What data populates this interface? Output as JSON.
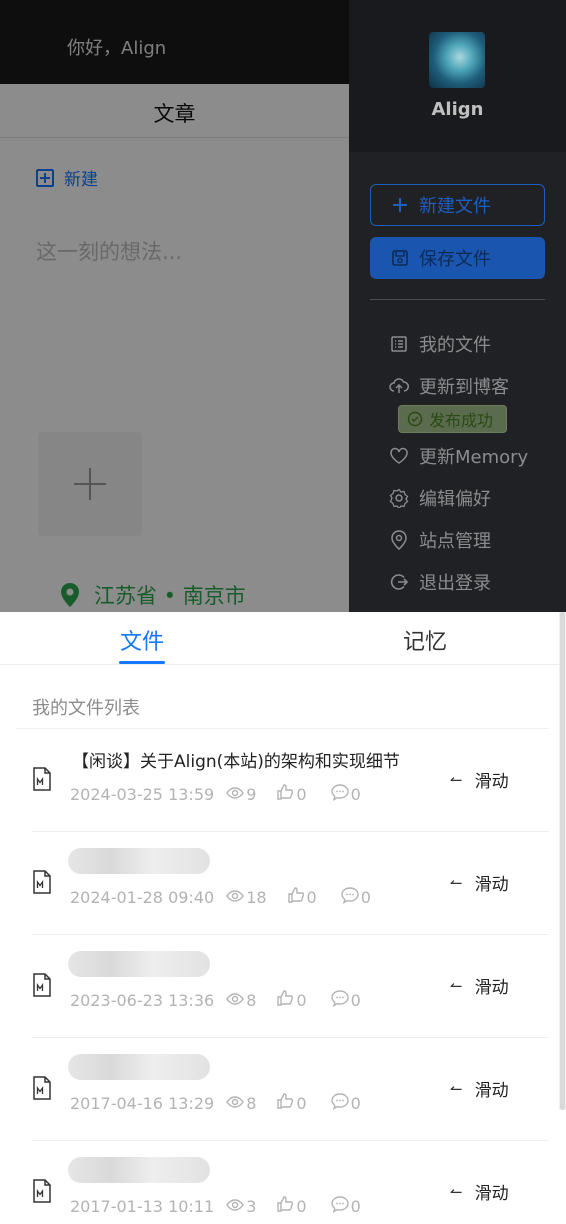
{
  "background": {
    "greeting": "你好，Align",
    "tab_label": "文章",
    "new_label": "新建",
    "thought_placeholder": "这一刻的想法...",
    "location": "江苏省 • 南京市"
  },
  "drawer": {
    "user_name": "Align",
    "new_file_label": "新建文件",
    "save_file_label": "保存文件",
    "menu": [
      {
        "label": "我的文件",
        "icon": "list-icon"
      },
      {
        "label": "更新到博客",
        "icon": "cloud-upload-icon"
      },
      {
        "label": "更新Memory",
        "icon": "heart-icon"
      },
      {
        "label": "编辑偏好",
        "icon": "gear-icon"
      },
      {
        "label": "站点管理",
        "icon": "location-pin-icon"
      },
      {
        "label": "退出登录",
        "icon": "logout-icon"
      }
    ],
    "publish_badge": "发布成功"
  },
  "sheet": {
    "tabs": [
      {
        "label": "文件",
        "active": true
      },
      {
        "label": "记忆",
        "active": false
      }
    ],
    "list_title": "我的文件列表",
    "swipe_label": "滑动",
    "files": [
      {
        "title": "【闲谈】关于Align(本站)的架构和实现细节",
        "date": "2024-03-25 13:59",
        "views": "9",
        "likes": "0",
        "comments": "0"
      },
      {
        "title": "",
        "date": "2024-01-28 09:40",
        "views": "18",
        "likes": "0",
        "comments": "0"
      },
      {
        "title": "",
        "date": "2023-06-23 13:36",
        "views": "8",
        "likes": "0",
        "comments": "0"
      },
      {
        "title": "",
        "date": "2017-04-16 13:29",
        "views": "8",
        "likes": "0",
        "comments": "0"
      },
      {
        "title": "",
        "date": "2017-01-13 10:11",
        "views": "3",
        "likes": "0",
        "comments": "0"
      }
    ]
  },
  "colors": {
    "accent": "#1677ff",
    "drawer_bg": "#202125",
    "location_green": "#2fa84f"
  }
}
